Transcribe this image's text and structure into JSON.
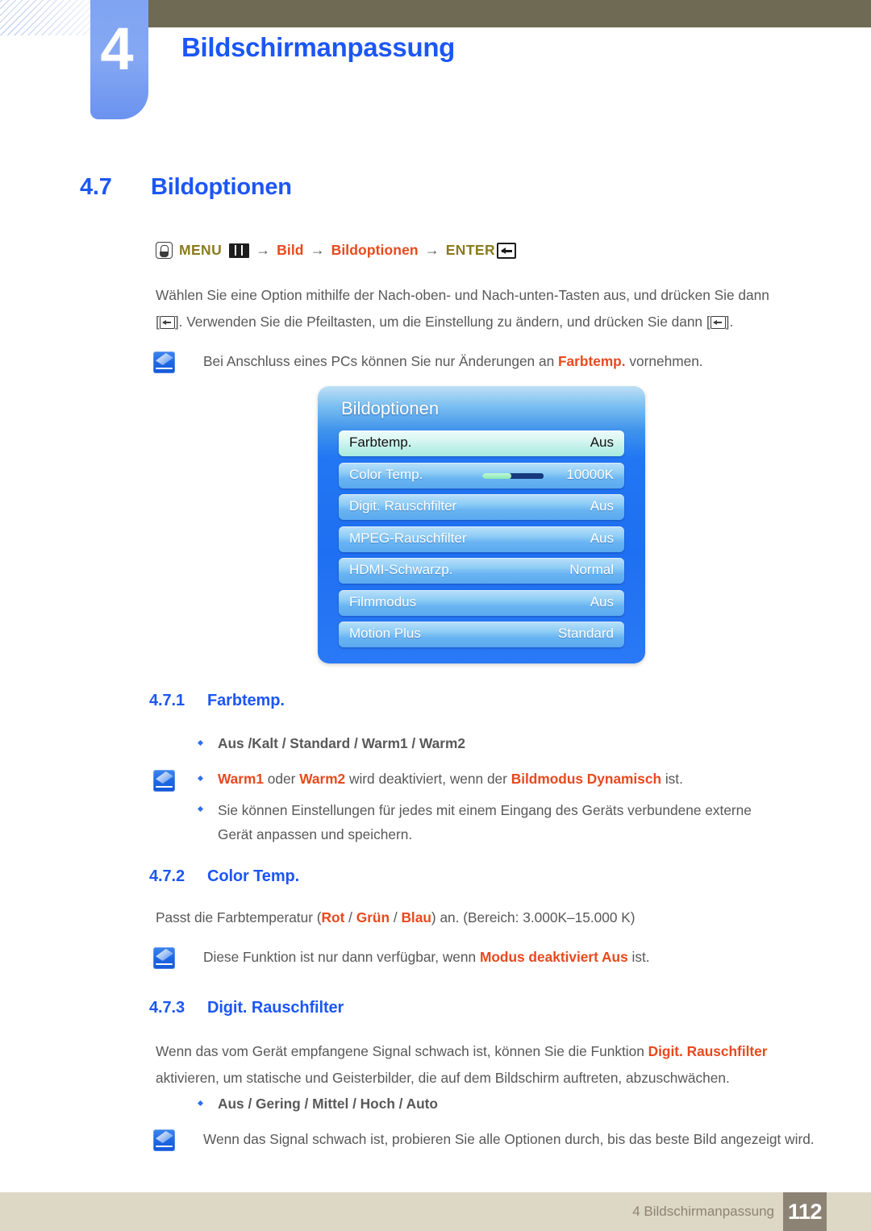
{
  "header": {
    "chapter_number": "4",
    "chapter_title": "Bildschirmanpassung"
  },
  "section": {
    "number": "4.7",
    "title": "Bildoptionen"
  },
  "menu_path": {
    "hand_icon": "hand-press-icon",
    "menu_label": "MENU",
    "grid_icon": "menu-grid-icon",
    "arrow1": "→",
    "item1": "Bild",
    "arrow2": "→",
    "item2": "Bildoptionen",
    "arrow3": "→",
    "enter_label": "ENTER",
    "enter_icon": "enter-return-icon"
  },
  "intro": {
    "line1": "Wählen Sie eine Option mithilfe der Nach-oben- und Nach-unten-Tasten aus, und drücken Sie dann",
    "line2_a": "[",
    "line2_b": "]. Verwenden Sie die Pfeiltasten, um die Einstellung zu ändern, und drücken Sie dann [",
    "line2_c": "]."
  },
  "note_pc": {
    "before": "Bei Anschluss eines PCs können Sie nur Änderungen an ",
    "highlight": "Farbtemp.",
    "after": " vornehmen."
  },
  "osd": {
    "title": "Bildoptionen",
    "rows": [
      {
        "label": "Farbtemp.",
        "value": "Aus",
        "selected": true,
        "slider": false
      },
      {
        "label": "Color Temp.",
        "value": "10000K",
        "selected": false,
        "slider": true,
        "slider_fill_percent": 48
      },
      {
        "label": "Digit. Rauschfilter",
        "value": "Aus",
        "selected": false,
        "slider": false
      },
      {
        "label": "MPEG-Rauschfilter",
        "value": "Aus",
        "selected": false,
        "slider": false
      },
      {
        "label": "HDMI-Schwarzp.",
        "value": "Normal",
        "selected": false,
        "slider": false
      },
      {
        "label": "Filmmodus",
        "value": "Aus",
        "selected": false,
        "slider": false
      },
      {
        "label": "Motion Plus",
        "value": "Standard",
        "selected": false,
        "slider": false
      }
    ]
  },
  "sub1": {
    "number": "4.7.1",
    "title": "Farbtemp.",
    "options": "Aus /Kalt / Standard / Warm1 / Warm2",
    "note_a_1": "Warm1",
    "note_a_2": " oder ",
    "note_a_3": "Warm2",
    "note_a_4": " wird deaktiviert, wenn der ",
    "note_a_5": "Bildmodus Dynamisch",
    "note_a_6": " ist.",
    "note_b": "Sie können Einstellungen für jedes mit einem Eingang des Geräts verbundene externe Gerät anpassen und speichern."
  },
  "sub2": {
    "number": "4.7.2",
    "title": "Color Temp.",
    "body_1": "Passt die Farbtemperatur (",
    "body_red1": "Rot",
    "body_2": " / ",
    "body_red2": "Grün",
    "body_3": " / ",
    "body_red3": "Blau",
    "body_4": ") an. (Bereich: 3.000K–15.000 K)",
    "note_1": "Diese Funktion ist nur dann verfügbar, wenn ",
    "note_red": "Modus deaktiviert Aus",
    "note_2": " ist."
  },
  "sub3": {
    "number": "4.7.3",
    "title": "Digit. Rauschfilter",
    "body_1": "Wenn das vom Gerät empfangene Signal schwach ist, können Sie die Funktion ",
    "body_red": "Digit. Rauschfilter",
    "body_2": " aktivieren, um statische und Geisterbilder, die auf dem Bildschirm auftreten, abzuschwächen.",
    "options": "Aus / Gering / Mittel / Hoch / Auto",
    "note": "Wenn das Signal schwach ist, probieren Sie alle Optionen durch, bis das beste Bild angezeigt wird."
  },
  "footer": {
    "text": "4 Bildschirmanpassung",
    "page": "112"
  },
  "colors": {
    "accent_blue": "#1c56f5",
    "highlight_red": "#e8491d",
    "menu_olive": "#8a7b1e",
    "header_olive": "#6e6a54",
    "footer_bg": "#ddd7c6",
    "footer_page_bg": "#8d8374"
  }
}
